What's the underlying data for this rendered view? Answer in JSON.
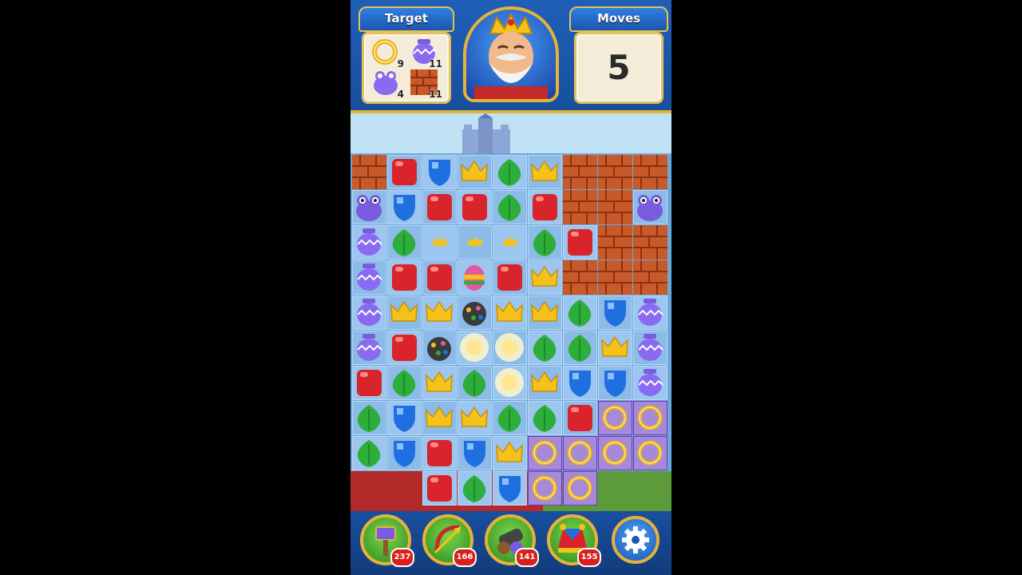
{
  "header": {
    "target_label": "Target",
    "moves_label": "Moves",
    "moves_value": "5"
  },
  "targets": [
    {
      "icon": "ring-icon",
      "count": "9"
    },
    {
      "icon": "vase-icon",
      "count": "11"
    },
    {
      "icon": "frog-icon",
      "count": "4"
    },
    {
      "icon": "roof-tile-icon",
      "count": "11"
    }
  ],
  "boosters": [
    {
      "icon": "hammer-icon",
      "count": "237"
    },
    {
      "icon": "arrow-icon",
      "count": "166"
    },
    {
      "icon": "cannon-icon",
      "count": "141"
    },
    {
      "icon": "jester-hat-icon",
      "count": "155"
    }
  ],
  "settings_icon": "gear-icon",
  "colors": {
    "red": "#d8242a",
    "blue": "#1f6fe0",
    "yellow": "#f4c21a",
    "green": "#2dae3a",
    "purple": "#7a5adf",
    "roof": "#c85a2a",
    "gold": "#e6b23a"
  },
  "board": {
    "cols": 9,
    "rows": 9,
    "grid": [
      [
        "roof",
        "red",
        "blue",
        "crown",
        "leaf",
        "crown",
        "roof",
        "roof",
        "roof"
      ],
      [
        "frog",
        "blue",
        "red",
        "red",
        "leaf",
        "red",
        "roof",
        "roof",
        "frog"
      ],
      [
        "vase",
        "leaf",
        "smallcrown",
        "smallcrown",
        "smallcrown",
        "leaf",
        "red",
        "roof",
        "roof"
      ],
      [
        "vase",
        "red",
        "red",
        "egg",
        "red",
        "crown",
        "roof",
        "roof",
        "roof"
      ],
      [
        "vase",
        "crown",
        "crown",
        "bomb",
        "crown",
        "crown",
        "leaf",
        "blue",
        "vase"
      ],
      [
        "vase",
        "red",
        "bomb",
        "blast",
        "blast",
        "leaf",
        "leaf",
        "crown",
        "vase"
      ],
      [
        "red",
        "leaf",
        "crown",
        "leaf",
        "blast",
        "crown",
        "blue",
        "blue",
        "vase"
      ],
      [
        "leaf",
        "blue",
        "crown",
        "crown",
        "leaf",
        "leaf",
        "red",
        "ring",
        "ring"
      ],
      [
        "leaf",
        "blue",
        "red",
        "blue",
        "crown",
        "ring",
        "ring",
        "ring",
        "ring"
      ]
    ],
    "extra_row": [
      "",
      "",
      "red",
      "leaf",
      "blue",
      "ring",
      "ring",
      "",
      ""
    ]
  }
}
